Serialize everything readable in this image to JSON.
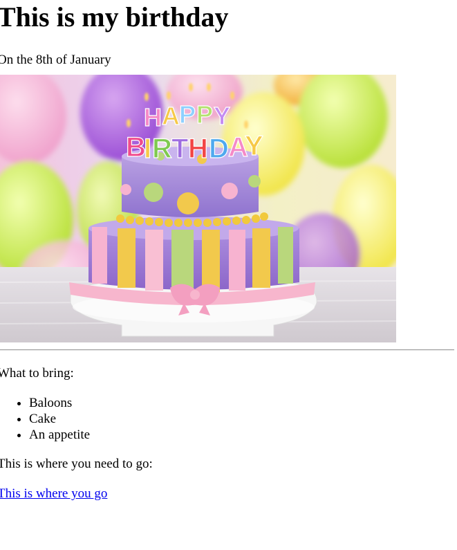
{
  "heading": "This is my birthday",
  "date_text": "On the 8th of January",
  "image": {
    "description_icon": "birthday-cake-image",
    "topper_text": [
      "HAPPY",
      "BIRTHDAY"
    ],
    "colors": {
      "cake_top": "#a68ad6",
      "cake_bottom": "#9b78d0",
      "stripe_yellow": "#f2c94c",
      "stripe_green": "#b9d77c",
      "stripe_pink": "#f7b3d0",
      "ribbon": "#f9bfd3"
    }
  },
  "bring_label": "What to bring:",
  "bring_items": [
    "Baloons",
    "Cake",
    "An appetite"
  ],
  "where_label": "This is where you need to go:",
  "link_text": "This is where you go",
  "colors": {
    "link": "#0000ee",
    "rule": "#9a9a9a"
  }
}
